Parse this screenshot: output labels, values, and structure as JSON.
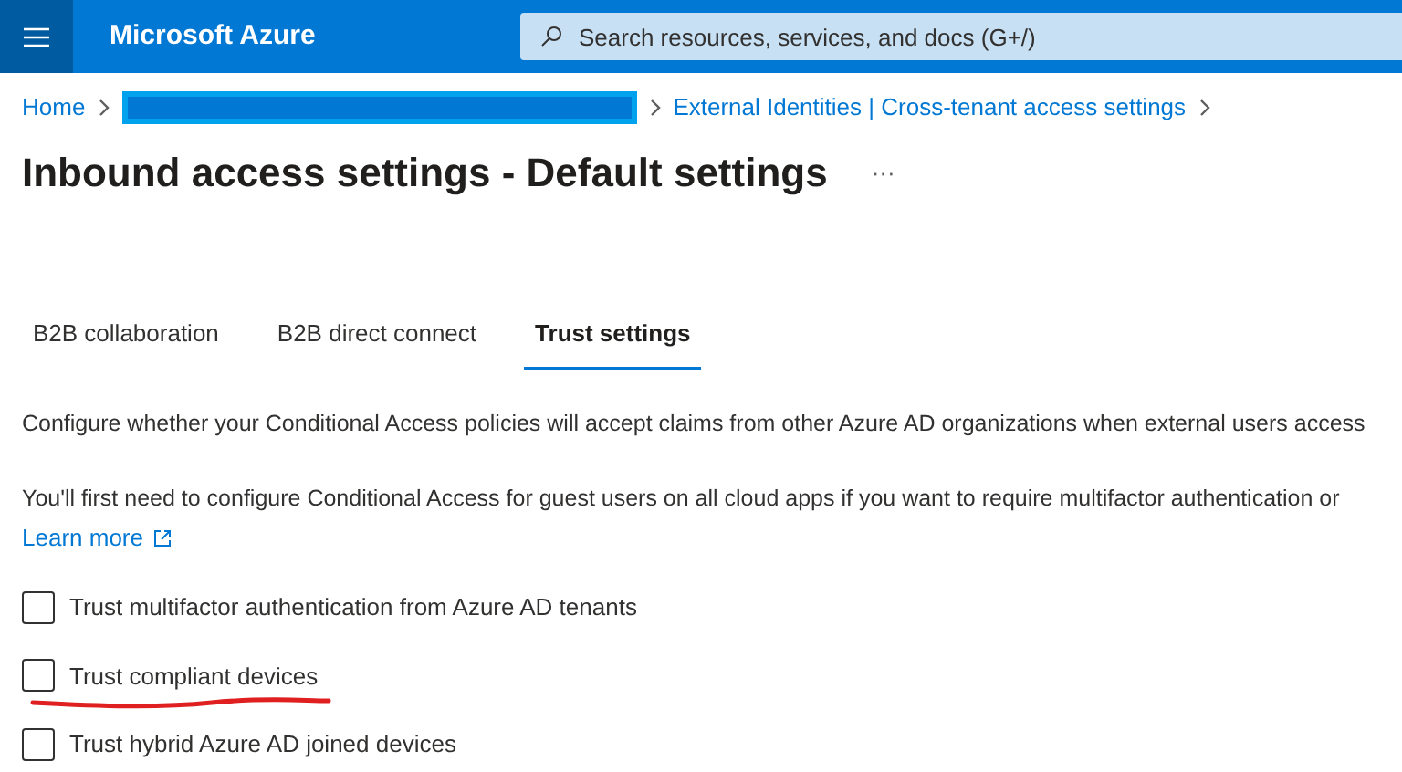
{
  "header": {
    "brand": "Microsoft Azure",
    "search": {
      "placeholder": "Search resources, services, and docs (G+/)"
    }
  },
  "breadcrumb": [
    {
      "label": "Home",
      "redacted": false
    },
    {
      "redacted": true
    },
    {
      "label": "External Identities | Cross-tenant access settings",
      "redacted": false
    }
  ],
  "title": "Inbound access settings - Default settings",
  "more_menu": "···",
  "tabs": [
    {
      "label": "B2B collaboration",
      "selected": false
    },
    {
      "label": "B2B direct connect",
      "selected": false
    },
    {
      "label": "Trust settings",
      "selected": true
    }
  ],
  "description": "Configure whether your Conditional Access policies will accept claims from other Azure AD organizations when external users access",
  "note": "You'll first need to configure Conditional Access for guest users on all cloud apps if you want to require multifactor authentication or",
  "learn_more": "Learn more",
  "options": [
    {
      "label": "Trust multifactor authentication from Azure AD tenants",
      "checked": false,
      "annotated": false
    },
    {
      "label": "Trust compliant devices",
      "checked": false,
      "annotated": true
    },
    {
      "label": "Trust hybrid Azure AD joined devices",
      "checked": false,
      "annotated": false
    }
  ]
}
